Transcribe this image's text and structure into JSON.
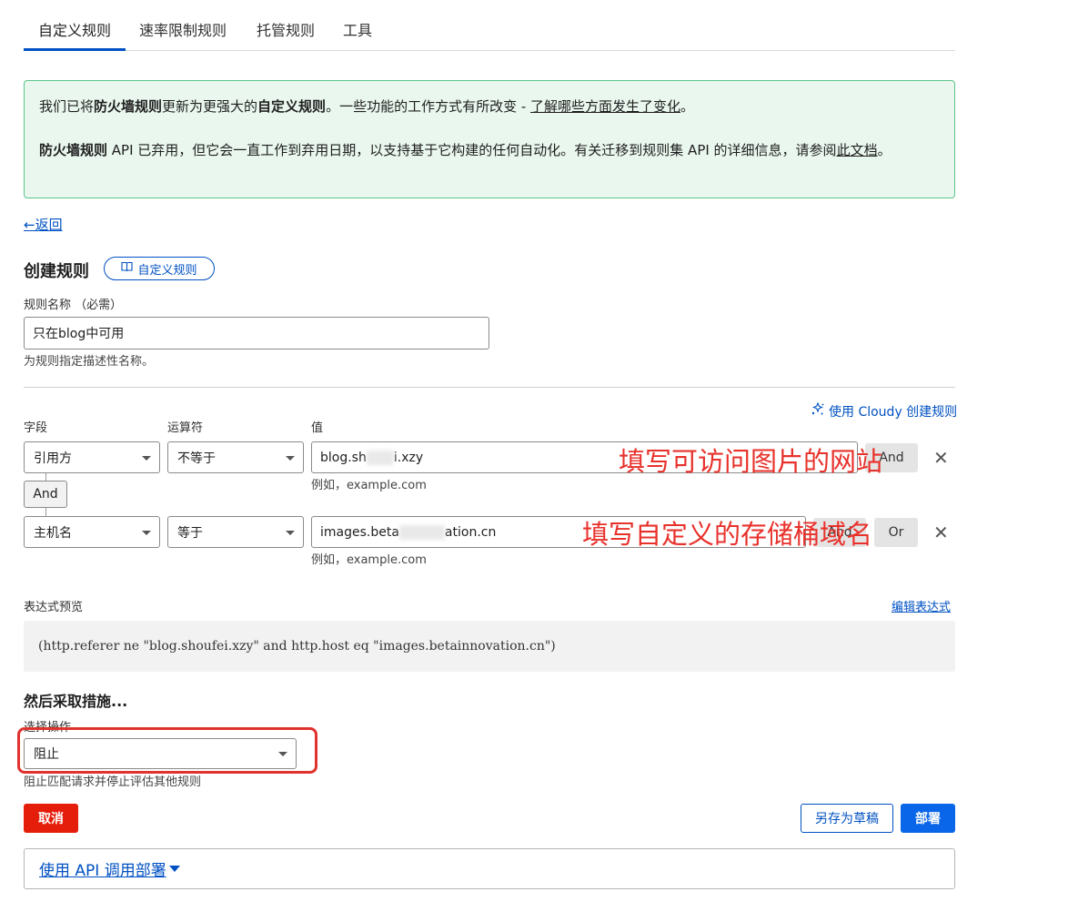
{
  "tabs": [
    {
      "label": "自定义规则"
    },
    {
      "label": "速率限制规则"
    },
    {
      "label": "托管规则"
    },
    {
      "label": "工具"
    }
  ],
  "notice": {
    "l1_a": "我们已将",
    "l1_b": "防火墙规则",
    "l1_c": "更新为更强大的",
    "l1_d": "自定义规则",
    "l1_e": "。一些功能的工作方式有所改变 - ",
    "l1_link": "了解哪些方面发生了变化",
    "l1_f": "。",
    "l2_a": "防火墙规则",
    "l2_b": " API 已弃用，但它会一直工作到弃用日期，以支持基于它构建的任何自动化。有关迁移到规则集 API 的详细信息，请参阅",
    "l2_link": "此文档",
    "l2_c": "。"
  },
  "back": "←返回",
  "create": {
    "title": "创建规则",
    "pill_label": "自定义规则",
    "name_label": "规则名称 （必需）",
    "name_value": "只在blog中可用",
    "name_helper": "为规则指定描述性名称。"
  },
  "cloudy_label": "使用 Cloudy 创建规则",
  "columns": {
    "field": "字段",
    "operator": "运算符",
    "value": "值"
  },
  "conditions": [
    {
      "field": "引用方",
      "operator": "不等于",
      "value_a": "blog.sh",
      "value_b": "i.xzy",
      "example": "例如，example.com",
      "logic": "And"
    },
    {
      "field": "主机名",
      "operator": "等于",
      "value_a": "images.beta",
      "value_b": "ation.cn",
      "example": "例如，example.com",
      "logic_and": "And",
      "logic_or": "Or"
    }
  ],
  "and_connector": "And",
  "annotations": {
    "a1": "填写可访问图片的网站",
    "a2": "填写自定义的存储桶域名"
  },
  "expression": {
    "label": "表达式预览",
    "edit_link": "编辑表达式",
    "text": "(http.referer ne \"blog.shoufei.xzy\" and http.host eq \"images.betainnovation.cn\")"
  },
  "action": {
    "heading": "然后采取措施...",
    "label": "选择操作",
    "selected": "阻止",
    "helper": "阻止匹配请求并停止评估其他规则"
  },
  "buttons": {
    "cancel": "取消",
    "draft": "另存为草稿",
    "deploy": "部署"
  },
  "api_deploy": "使用 API 调用部署",
  "colors": {
    "accent": "#0051c3",
    "danger": "#e51e0b",
    "annotation": "#e8312b",
    "notice_bg": "#e9f7ee"
  }
}
